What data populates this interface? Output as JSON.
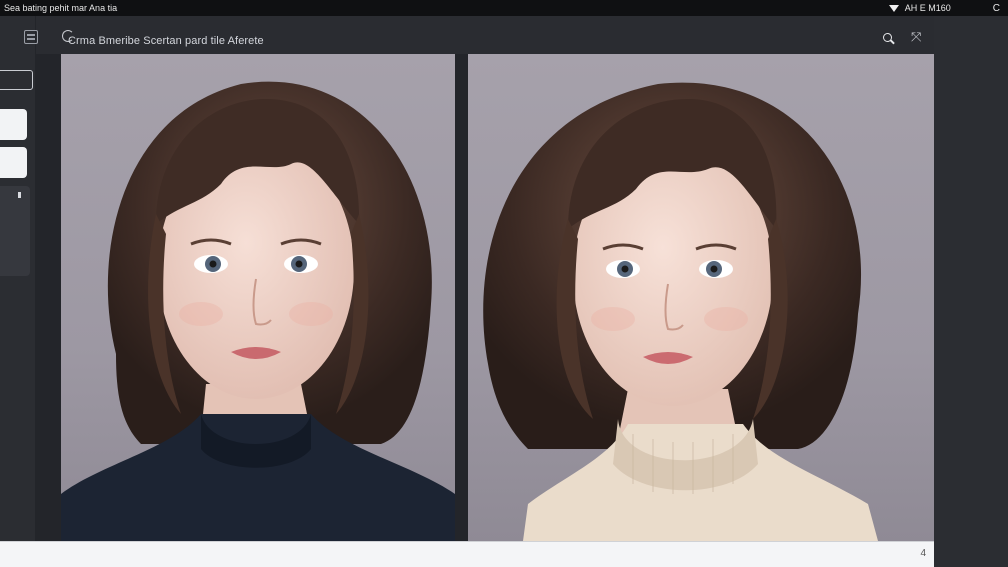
{
  "statusbar": {
    "left_text": "Sea bating pehit mar Ana tia",
    "right_text": "AH E  M160",
    "wifi_icon": "wifi-icon",
    "reload_icon": "reload-icon",
    "reload_glyph": "C"
  },
  "header": {
    "title": "Crma Bmeribe Scertan pard tile Aferete",
    "search_icon": "search-icon",
    "collapse_icon": "collapse-icon",
    "collapse_glyph": "⤧"
  },
  "sidebar": {
    "menu_icon": "menu-icon"
  },
  "images": [
    {
      "name": "portrait-left",
      "sweater": "navy"
    },
    {
      "name": "portrait-right",
      "sweater": "cream"
    }
  ],
  "bottombar": {
    "page_indicator": "4"
  },
  "colors": {
    "background": "#2a2c31",
    "topbar": "#0f1012",
    "bottombar": "#f4f5f7",
    "image_bg": "#a6a1ab"
  }
}
